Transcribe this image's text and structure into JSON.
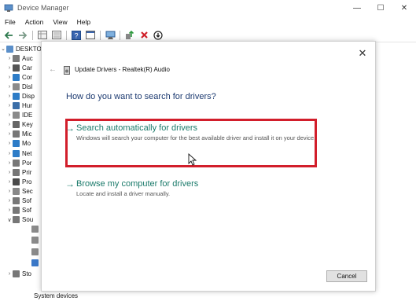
{
  "window": {
    "title": "Device Manager"
  },
  "menu": [
    "File",
    "Action",
    "View",
    "Help"
  ],
  "tree": {
    "root": "DESKTO",
    "items": [
      {
        "label": "Auc",
        "color": "#7a7a7a"
      },
      {
        "label": "Car",
        "color": "#555555"
      },
      {
        "label": "Cor",
        "color": "#2d7cc7"
      },
      {
        "label": "Disl",
        "color": "#8a8a8a"
      },
      {
        "label": "Disp",
        "color": "#2d7cc7"
      },
      {
        "label": "Hur",
        "color": "#3b6ea8"
      },
      {
        "label": "IDE",
        "color": "#8a8a8a"
      },
      {
        "label": "Key",
        "color": "#666666"
      },
      {
        "label": "Mic",
        "color": "#777777"
      },
      {
        "label": "Mo",
        "color": "#2d7cc7"
      },
      {
        "label": "Net",
        "color": "#2d7cc7"
      },
      {
        "label": "Por",
        "color": "#777777"
      },
      {
        "label": "Prir",
        "color": "#777777"
      },
      {
        "label": "Pro",
        "color": "#4a4a4a"
      },
      {
        "label": "Sec",
        "color": "#888888"
      },
      {
        "label": "Sof",
        "color": "#777777"
      },
      {
        "label": "Sof",
        "color": "#777777"
      },
      {
        "label": "Sou",
        "color": "#777777"
      }
    ],
    "after": [
      {
        "label": "Sto",
        "color": "#777777"
      }
    ],
    "bottom_partial": "System devices"
  },
  "dialog": {
    "title": "Update Drivers - Realtek(R) Audio",
    "question": "How do you want to search for drivers?",
    "options": [
      {
        "title": "Search automatically for drivers",
        "desc": "Windows will search your computer for the best available driver and install it on your device."
      },
      {
        "title": "Browse my computer for drivers",
        "desc": "Locate and install a driver manually."
      }
    ],
    "cancel": "Cancel"
  },
  "colors": {
    "accent": "#1a7a6a",
    "highlight": "#d21e2b",
    "question": "#1c3a70"
  }
}
